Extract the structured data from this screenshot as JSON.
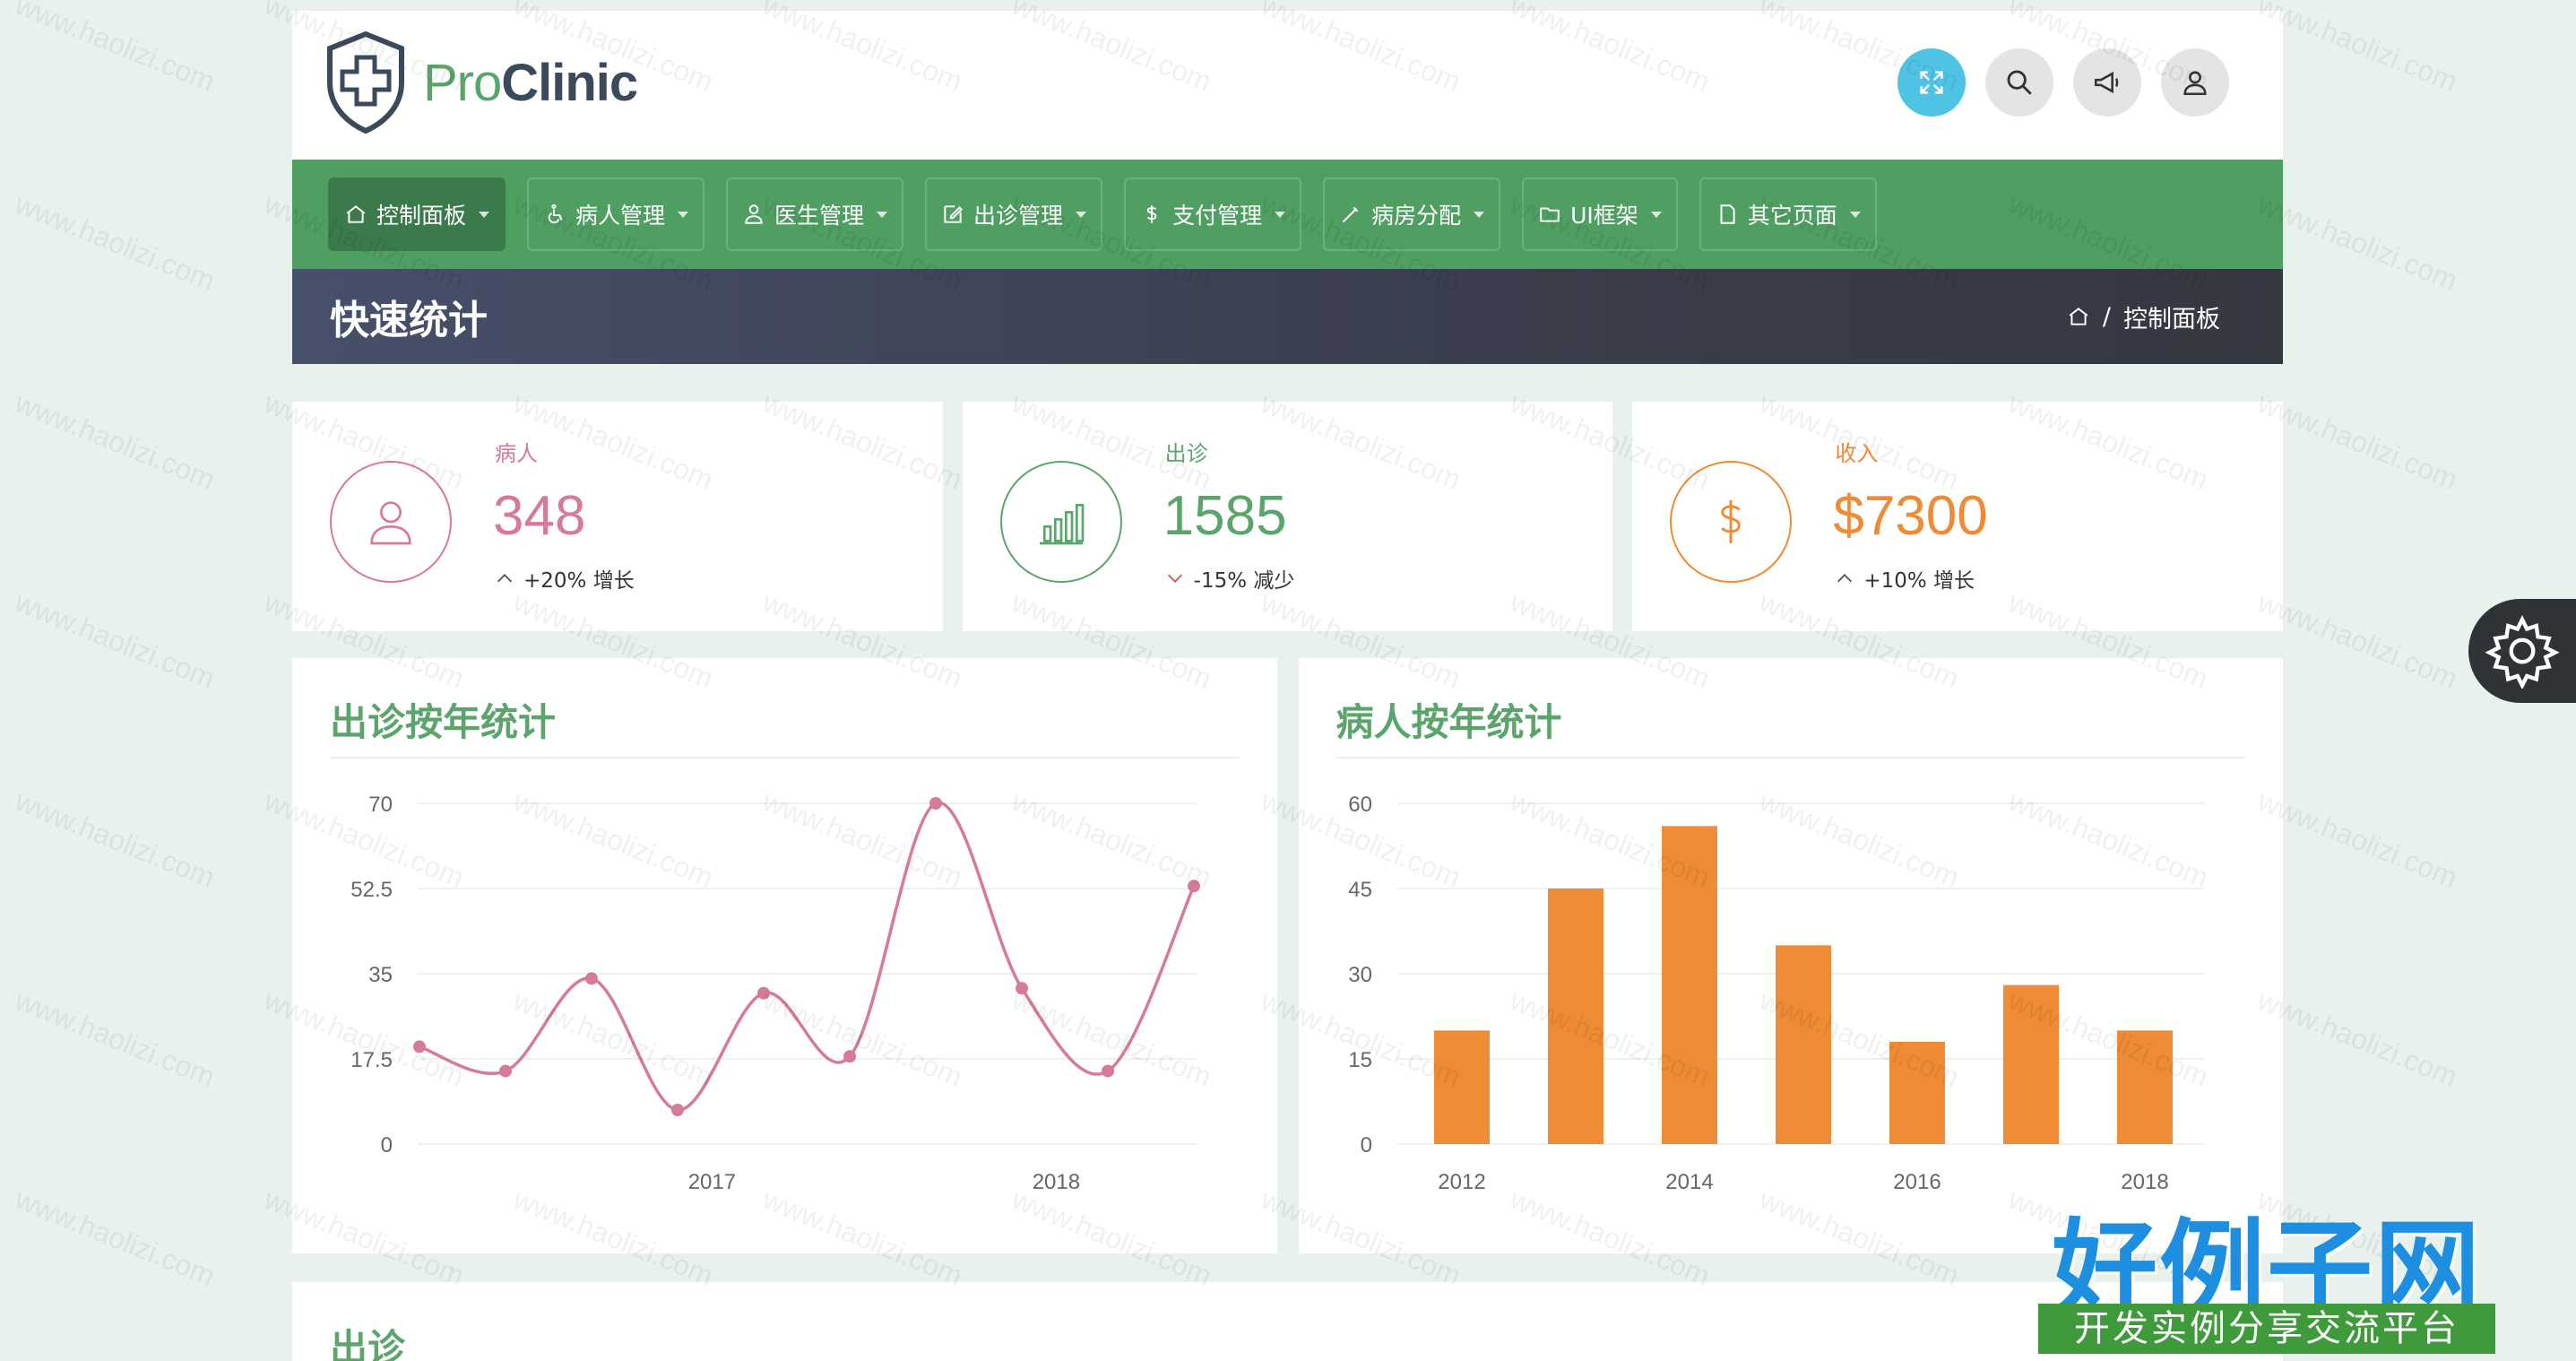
{
  "brand": {
    "pro": "Pro",
    "clinic": "Clinic"
  },
  "nav": [
    {
      "label": "控制面板",
      "icon": "home-icon",
      "active": true
    },
    {
      "label": "病人管理",
      "icon": "wheelchair-icon"
    },
    {
      "label": "医生管理",
      "icon": "doctor-icon"
    },
    {
      "label": "出诊管理",
      "icon": "edit-icon"
    },
    {
      "label": "支付管理",
      "icon": "dollar-icon"
    },
    {
      "label": "病房分配",
      "icon": "bed-icon"
    },
    {
      "label": "UI框架",
      "icon": "folder-icon"
    },
    {
      "label": "其它页面",
      "icon": "file-icon"
    }
  ],
  "page": {
    "title": "快速统计",
    "breadcrumb": "控制面板"
  },
  "stats": [
    {
      "label": "病人",
      "value": "348",
      "change": "+20% 增长",
      "direction": "up",
      "color": "#d67a9a",
      "icon": "user-icon"
    },
    {
      "label": "出诊",
      "value": "1585",
      "change": "-15% 减少",
      "direction": "down",
      "color": "#5ba56d",
      "icon": "bar-chart-icon"
    },
    {
      "label": "收入",
      "value": "$7300",
      "change": "+10% 增长",
      "direction": "up",
      "color": "#ef8a35",
      "icon": "dollar-icon"
    }
  ],
  "charts": {
    "visits_title": "出诊按年统计",
    "patients_title": "病人按年统计"
  },
  "chart_data": [
    {
      "type": "line",
      "title": "出诊按年统计",
      "x_tick_labels": [
        "2017",
        "2018"
      ],
      "y_ticks": [
        0,
        17.5,
        35,
        52.5,
        70
      ],
      "ylim": [
        0,
        70
      ],
      "series": [
        {
          "values": [
            20,
            15,
            34,
            7,
            31,
            18,
            70,
            32,
            15,
            53
          ]
        }
      ],
      "color": "#d67a9a"
    },
    {
      "type": "bar",
      "title": "病人按年统计",
      "categories": [
        "2012",
        "2013",
        "2014",
        "2015",
        "2016",
        "2017",
        "2018"
      ],
      "x_tick_labels": [
        "2012",
        "2014",
        "2016",
        "2018"
      ],
      "values": [
        20,
        45,
        56,
        35,
        18,
        28,
        20
      ],
      "y_ticks": [
        0,
        15,
        30,
        45,
        60
      ],
      "ylim": [
        0,
        60
      ],
      "color": "#ef8a35"
    }
  ],
  "bottom": {
    "title": "出诊"
  },
  "brand_badge": {
    "title": "好例子网",
    "subtitle": "开发实例分享交流平台"
  },
  "watermark": "www.haolizi.com"
}
